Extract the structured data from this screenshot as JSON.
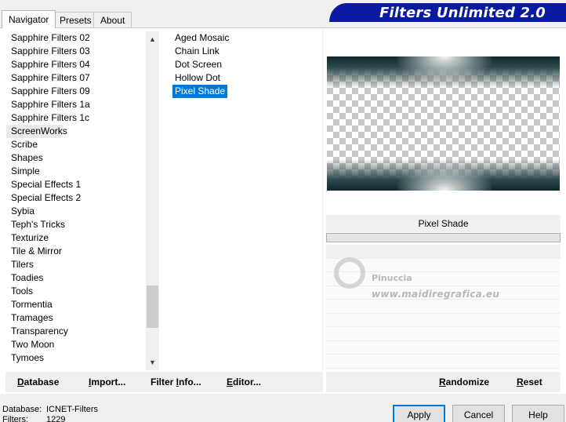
{
  "tabs": [
    {
      "label": "Navigator",
      "active": true
    },
    {
      "label": "Presets",
      "active": false
    },
    {
      "label": "About",
      "active": false
    }
  ],
  "banner": {
    "title": "Filters Unlimited 2.0",
    "color": "#0a1aa0"
  },
  "categories": {
    "items": [
      "Sapphire Filters 02",
      "Sapphire Filters 03",
      "Sapphire Filters 04",
      "Sapphire Filters 07",
      "Sapphire Filters 09",
      "Sapphire Filters 1a",
      "Sapphire Filters 1c",
      "ScreenWorks",
      "Scribe",
      "Shapes",
      "Simple",
      "Special Effects 1",
      "Special Effects 2",
      "Sybia",
      "Teph's Tricks",
      "Texturize",
      "Tile & Mirror",
      "Tilers",
      "Toadies",
      "Tools",
      "Tormentia",
      "Tramages",
      "Transparency",
      "Two Moon",
      "Tymoes"
    ],
    "selected": "ScreenWorks",
    "scroll_up_icon": "up-arrow-icon",
    "scroll_down_icon": "down-arrow-icon"
  },
  "filters": {
    "items": [
      "Aged Mosaic",
      "Chain Link",
      "Dot Screen",
      "Hollow Dot",
      "Pixel Shade"
    ],
    "selected": "Pixel Shade",
    "selected_color": "#0078d7"
  },
  "parameters": {
    "title": "Pixel Shade"
  },
  "watermark": {
    "name": "Pinuccia",
    "url": "www.maidiregrafica.eu"
  },
  "toolbar": {
    "database": {
      "u": "D",
      "rest": "atabase"
    },
    "import": {
      "u": "I",
      "rest": "mport..."
    },
    "filter_info": {
      "pre": "Filter ",
      "u": "I",
      "rest": "nfo..."
    },
    "editor": {
      "u": "E",
      "rest": "ditor..."
    },
    "randomize": {
      "u": "R",
      "rest": "andomize"
    },
    "reset": {
      "u": "R",
      "rest": "eset"
    }
  },
  "status": {
    "database_label": "Database:",
    "database_value": "ICNET-Filters",
    "filters_label": "Filters:",
    "filters_value": "1229"
  },
  "buttons": {
    "apply": "Apply",
    "cancel": "Cancel",
    "help": "Help"
  }
}
